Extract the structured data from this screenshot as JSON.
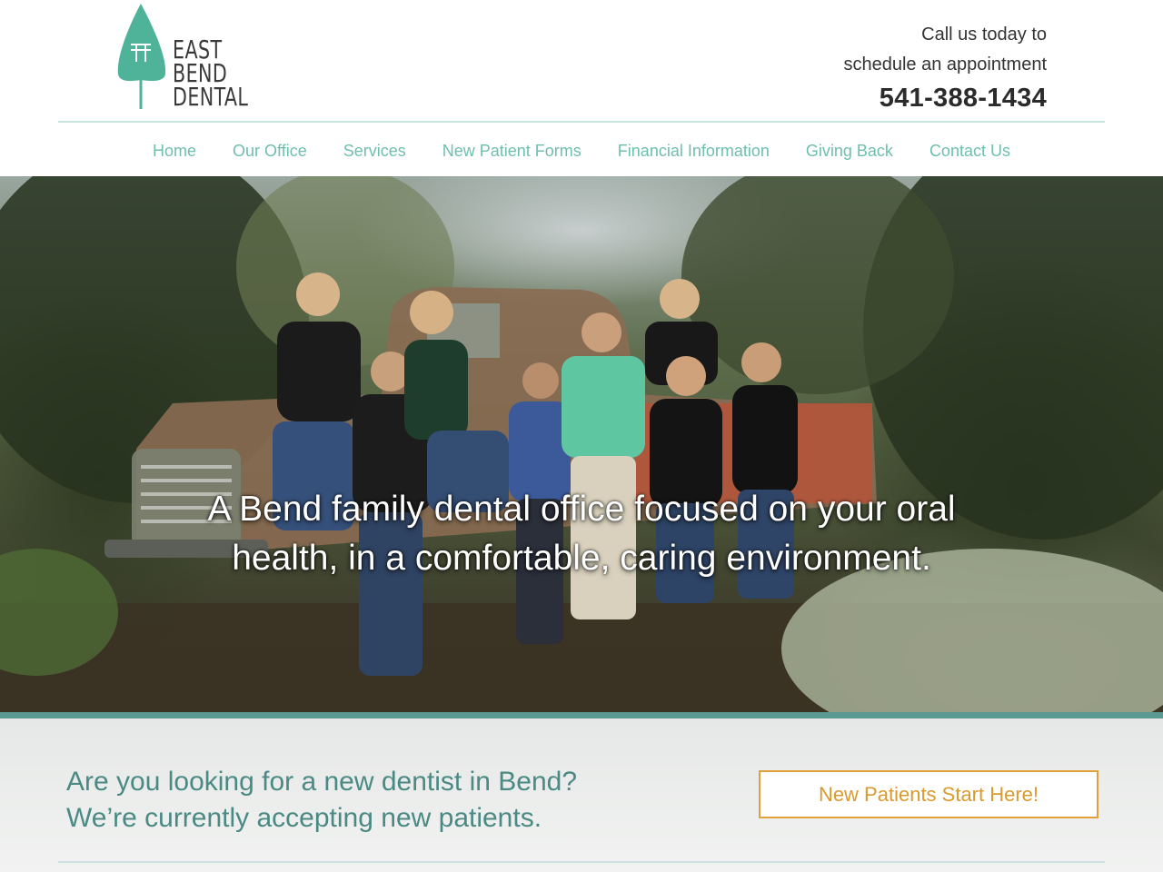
{
  "brand": {
    "line1": "EAST",
    "line2": "BEND",
    "line3": "DENTAL",
    "color_tree": "#4fb39a"
  },
  "contact": {
    "call_line1": "Call us today to",
    "call_line2": "schedule an appointment",
    "phone": "541-388-1434"
  },
  "nav": {
    "items": [
      {
        "label": "Home"
      },
      {
        "label": "Our Office"
      },
      {
        "label": "Services"
      },
      {
        "label": "New Patient Forms"
      },
      {
        "label": "Financial Information"
      },
      {
        "label": "Giving Back"
      },
      {
        "label": "Contact Us"
      }
    ],
    "color": "#6fbfae"
  },
  "hero": {
    "tagline_line1": "A Bend family dental office focused on your oral",
    "tagline_line2": "health, in a comfortable, caring environment."
  },
  "promo": {
    "line1": "Are you looking for a new dentist in Bend?",
    "line2": "We’re currently accepting new patients.",
    "cta_label": "New Patients Start Here!",
    "text_color": "#4b8a84",
    "cta_color": "#e0a13a"
  }
}
